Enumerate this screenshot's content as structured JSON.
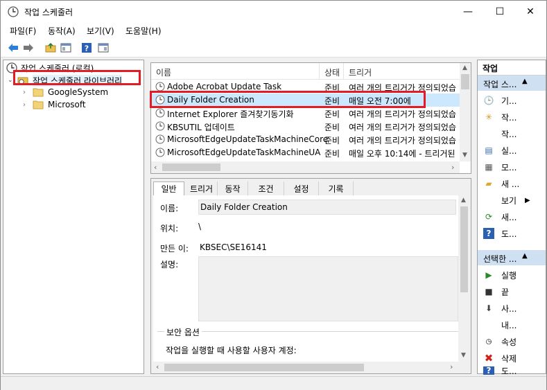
{
  "window": {
    "title": "작업 스케줄러",
    "minimize": "—",
    "maximize": "☐",
    "close": "✕"
  },
  "menu": [
    "파일(F)",
    "동작(A)",
    "보기(V)",
    "도움말(H)"
  ],
  "tree": {
    "root": "작업 스케줄러 (로컬)",
    "library": "작업 스케줄러 라이브러리",
    "children": [
      "GoogleSystem",
      "Microsoft"
    ]
  },
  "list": {
    "columns": [
      "이름",
      "상태",
      "트리거"
    ],
    "rows": [
      {
        "name": "Adobe Acrobat Update Task",
        "status": "준비",
        "trigger": "여러 개의 트리거가 정의되었습"
      },
      {
        "name": "Daily Folder Creation",
        "status": "준비",
        "trigger": "매일 오전 7:00에"
      },
      {
        "name": "Internet Explorer 즐겨찾기동기화",
        "status": "준비",
        "trigger": "여러 개의 트리거가 정의되었습"
      },
      {
        "name": "KBSUTIL 업데이트",
        "status": "준비",
        "trigger": "여러 개의 트리거가 정의되었습"
      },
      {
        "name": "MicrosoftEdgeUpdateTaskMachineCore",
        "status": "준비",
        "trigger": "여러 개의 트리거가 정의되었습"
      },
      {
        "name": "MicrosoftEdgeUpdateTaskMachineUA",
        "status": "준비",
        "trigger": "매일 오후 10:14에 - 트리거된"
      }
    ]
  },
  "details": {
    "tabs": [
      "일반",
      "트리거",
      "동작",
      "조건",
      "설정",
      "기록"
    ],
    "name_label": "이름:",
    "name_value": "Daily Folder Creation",
    "location_label": "위치:",
    "location_value": "\\",
    "author_label": "만든 이:",
    "author_value": "KBSEC\\SE16141",
    "desc_label": "설명:",
    "security_label": "보안 옵션",
    "security_text": "작업을 실행할 때 사용할 사용자 계정:"
  },
  "actions": {
    "header": "작업",
    "section1": "작업 스...",
    "items1": [
      "기...",
      "작...",
      "작...",
      "실...",
      "모...",
      "새 ...",
      "보기",
      "새...",
      "도..."
    ],
    "section2": "선택한 ...",
    "items2": [
      "실행",
      "끝",
      "사...",
      "내...",
      "속성",
      "삭제",
      "도..."
    ]
  },
  "colors": {
    "highlight": "#e31b23",
    "selection": "#cce8ff",
    "section": "#cfe0f2"
  }
}
